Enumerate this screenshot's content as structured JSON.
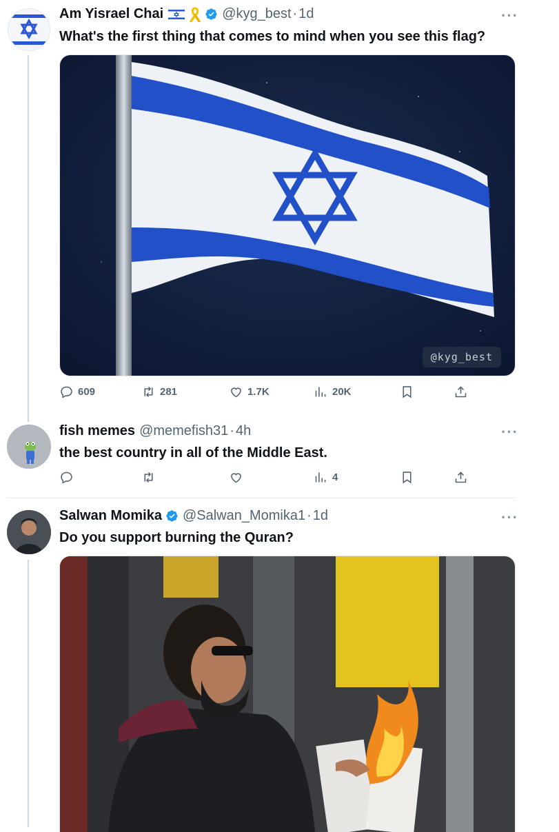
{
  "colors": {
    "accent": "#1d9bf0",
    "muted": "#536471",
    "line": "#cfd9de"
  },
  "tweets": [
    {
      "name": "Am Yisrael Chai",
      "handle": "@kyg_best",
      "time": "1d",
      "text": "What's the first thing that comes to mind when you see this flag?",
      "watermark": "@kyg_best",
      "actions": {
        "replies": "609",
        "reposts": "281",
        "likes": "1.7K",
        "views": "20K"
      }
    },
    {
      "name": "fish memes",
      "handle": "@memefish31",
      "time": "4h",
      "text": "the best country in all of the Middle East.",
      "actions": {
        "replies": "",
        "reposts": "",
        "likes": "",
        "views": "4"
      }
    },
    {
      "name": "Salwan Momika",
      "handle": "@Salwan_Momika1",
      "time": "1d",
      "text": "Do you support burning the Quran?"
    }
  ],
  "icons": [
    "reply-icon",
    "repost-icon",
    "like-icon",
    "views-icon",
    "bookmark-icon",
    "share-icon",
    "verified-icon",
    "more-icon"
  ],
  "dot": "·",
  "more": "···"
}
